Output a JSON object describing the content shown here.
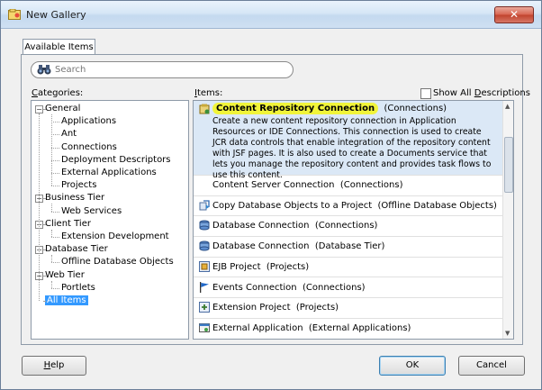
{
  "window": {
    "title": "New Gallery",
    "close": "✕"
  },
  "tab": {
    "label": "Available Items"
  },
  "search": {
    "placeholder": "Search"
  },
  "categories": {
    "header": "Categories:",
    "nodes": [
      {
        "label": "General",
        "level": 0,
        "toggle": "−"
      },
      {
        "label": "Applications",
        "level": 1
      },
      {
        "label": "Ant",
        "level": 1
      },
      {
        "label": "Connections",
        "level": 1
      },
      {
        "label": "Deployment Descriptors",
        "level": 1
      },
      {
        "label": "External Applications",
        "level": 1
      },
      {
        "label": "Projects",
        "level": 1
      },
      {
        "label": "Business Tier",
        "level": 0,
        "toggle": "−"
      },
      {
        "label": "Web Services",
        "level": 1
      },
      {
        "label": "Client Tier",
        "level": 0,
        "toggle": "−"
      },
      {
        "label": "Extension Development",
        "level": 1
      },
      {
        "label": "Database Tier",
        "level": 0,
        "toggle": "−"
      },
      {
        "label": "Offline Database Objects",
        "level": 1
      },
      {
        "label": "Web Tier",
        "level": 0,
        "toggle": "−"
      },
      {
        "label": "Portlets",
        "level": 1
      },
      {
        "label": "All Items",
        "level": 0,
        "selected": true
      }
    ]
  },
  "items": {
    "header": "Items:",
    "show_all": "Show All Descriptions",
    "list": [
      {
        "name": "Content Repository Connection",
        "category": "(Connections)",
        "description": "Create a new content repository connection in Application Resources or IDE Connections. This connection is used to create JCR data controls that enable integration of the repository content with JSF pages. It is also used to create a Documents service that lets you manage the repository content and provides task flows to use this content.",
        "icon": "content-repository-icon",
        "selected": true
      },
      {
        "name": "Content Server Connection",
        "category": "(Connections)",
        "icon": ""
      },
      {
        "name": "Copy Database Objects to a Project",
        "category": "(Offline Database Objects)",
        "icon": "copy-database-icon"
      },
      {
        "name": "Database Connection",
        "category": "(Connections)",
        "icon": "database-icon"
      },
      {
        "name": "Database Connection",
        "category": "(Database Tier)",
        "icon": "database-icon"
      },
      {
        "name": "EJB Project",
        "category": "(Projects)",
        "icon": "ejb-project-icon"
      },
      {
        "name": "Events Connection",
        "category": "(Connections)",
        "icon": "flag-icon"
      },
      {
        "name": "Extension Project",
        "category": "(Projects)",
        "icon": "extension-project-icon"
      },
      {
        "name": "External Application",
        "category": "(External Applications)",
        "icon": "external-app-icon"
      }
    ]
  },
  "buttons": {
    "help": "Help",
    "ok": "OK",
    "cancel": "Cancel"
  }
}
